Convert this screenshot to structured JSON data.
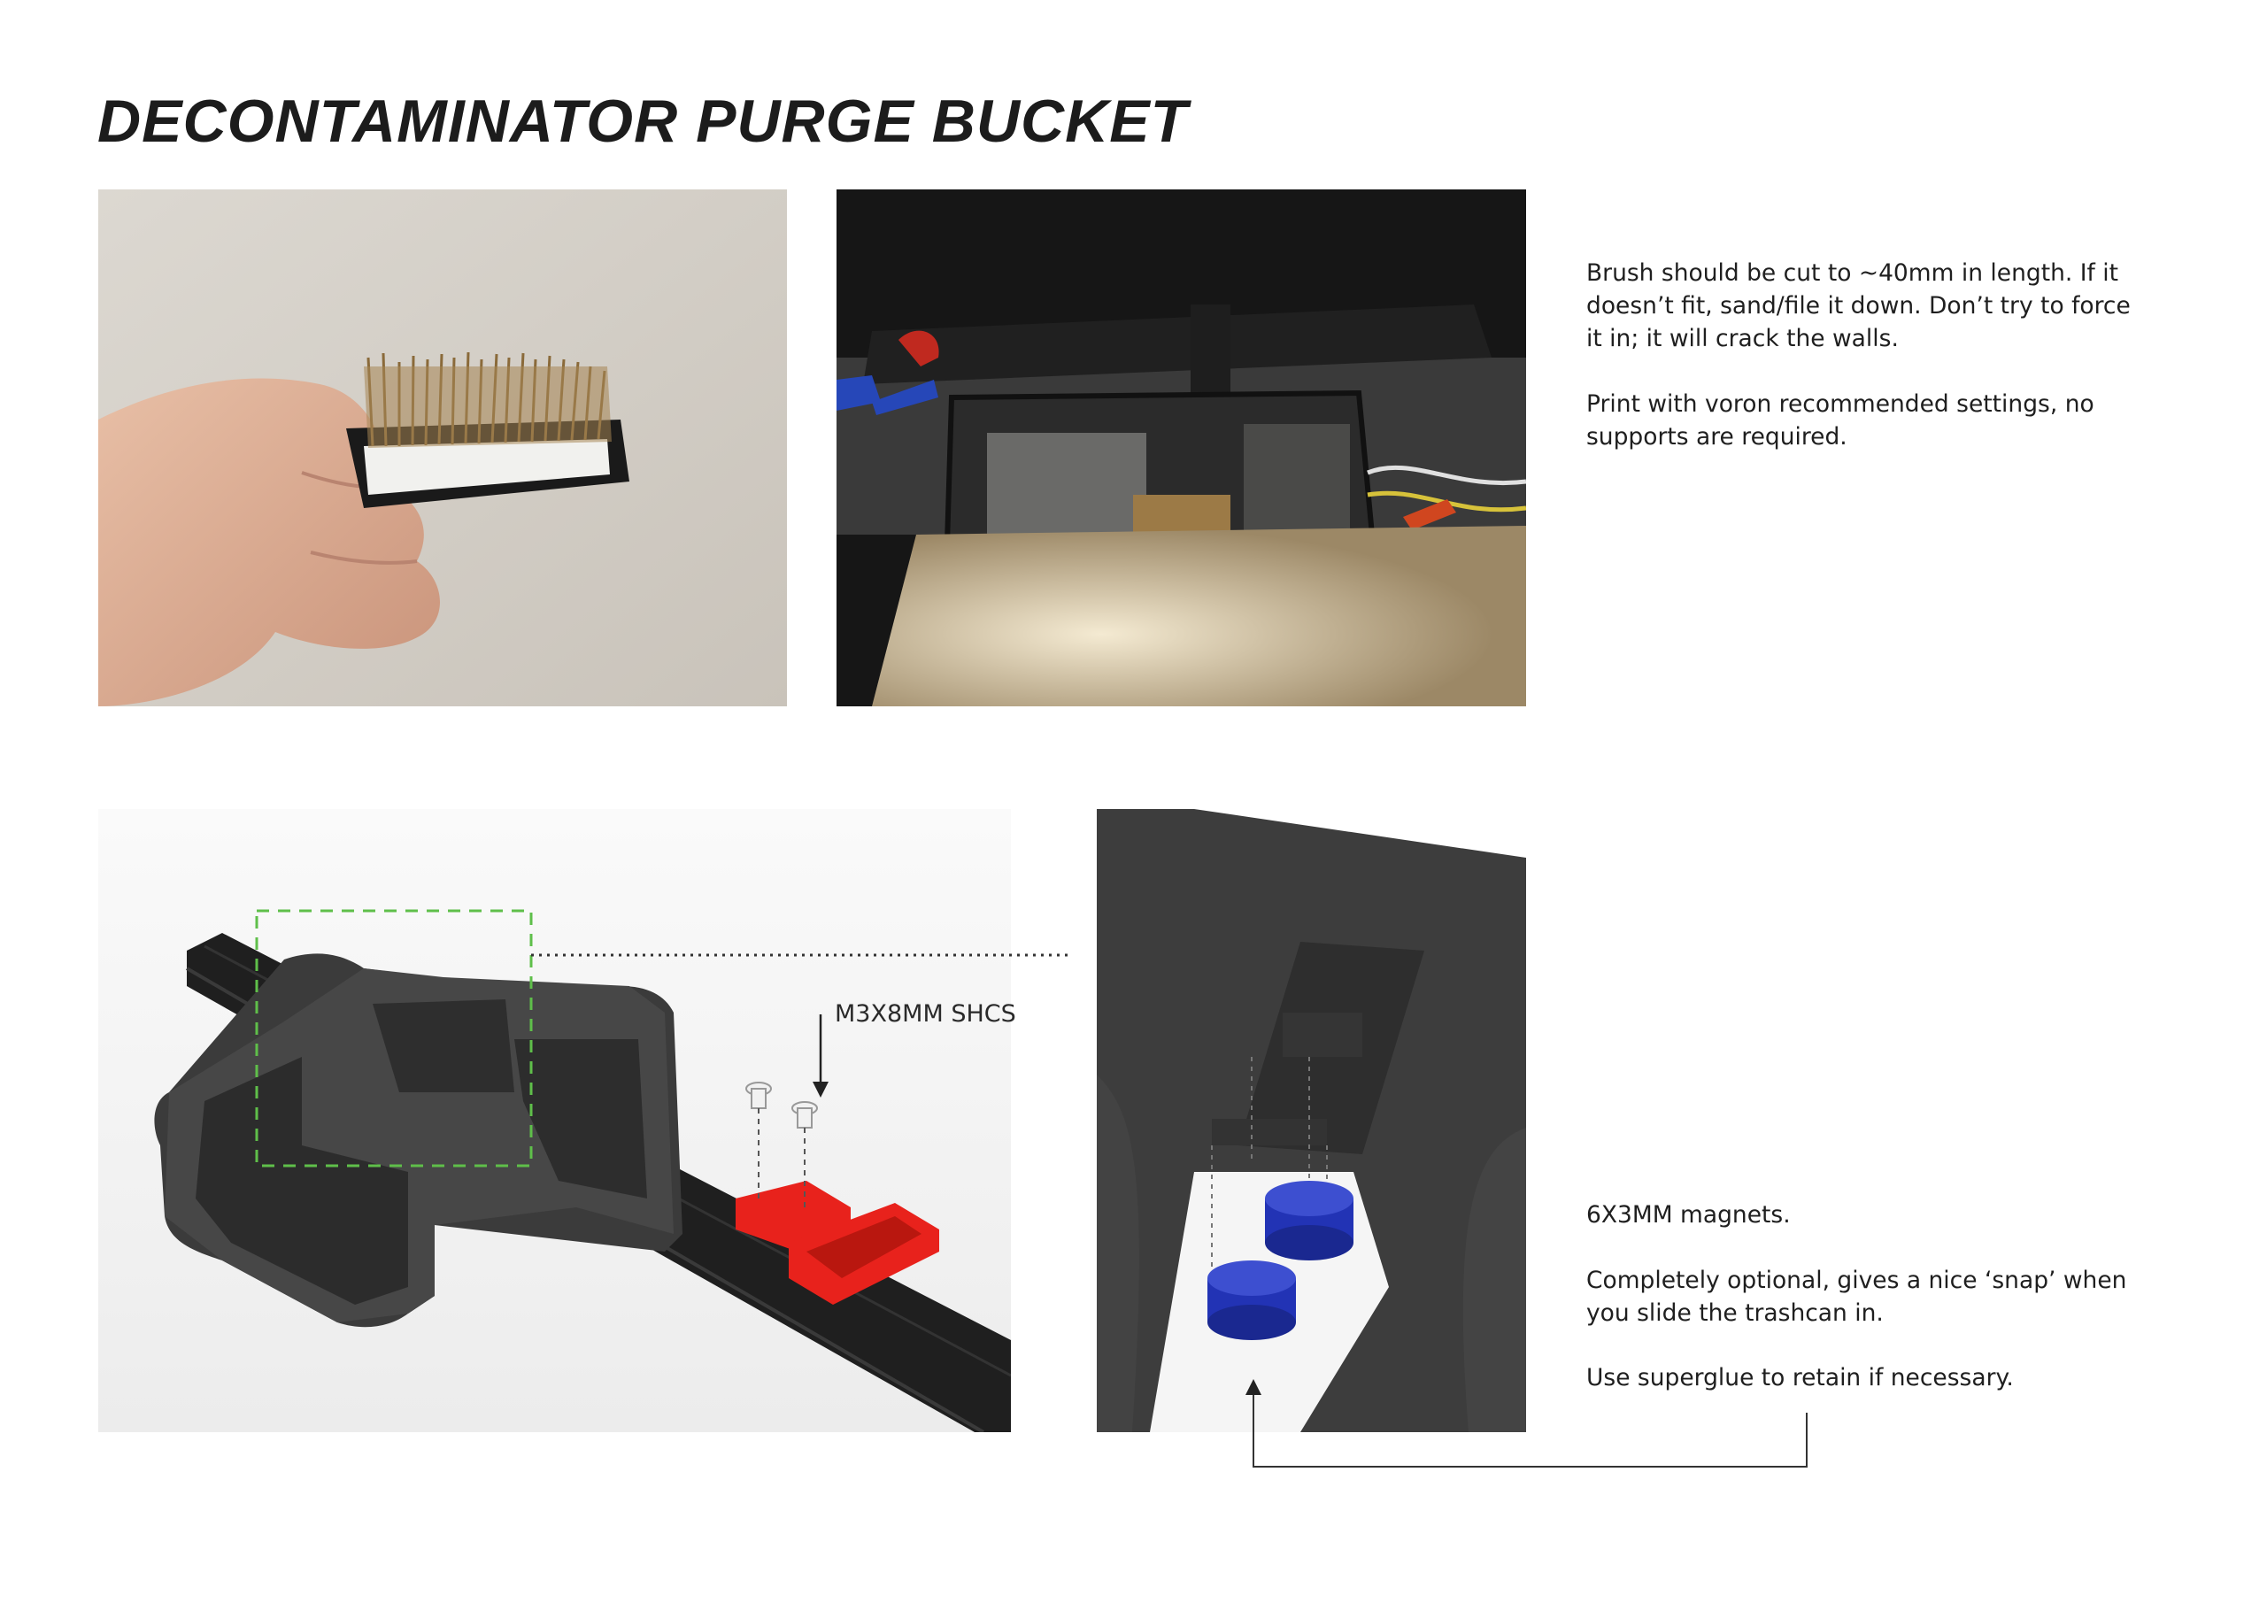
{
  "page": {
    "title": "DECONTAMINATOR PURGE BUCKET"
  },
  "notes": {
    "brush": "Brush should be cut to ~40mm in length. If it doesn’t fit, sand/file it down. Don’t try to force it in; it will crack the walls.",
    "print": "Print with voron recommended settings, no supports are required.",
    "magnets_title": "6X3MM magnets.",
    "magnets_optional": "Completely optional, gives a nice ‘snap’ when you slide the trashcan in.",
    "magnets_glue": "Use superglue to retain if necessary."
  },
  "callouts": {
    "screws": "M3X8MM SHCS"
  },
  "colors": {
    "bracket": "#e8221c",
    "magnet": "#2233b5",
    "highlight_box": "#5fbf4a",
    "render_dark": "#3b3b3b"
  }
}
